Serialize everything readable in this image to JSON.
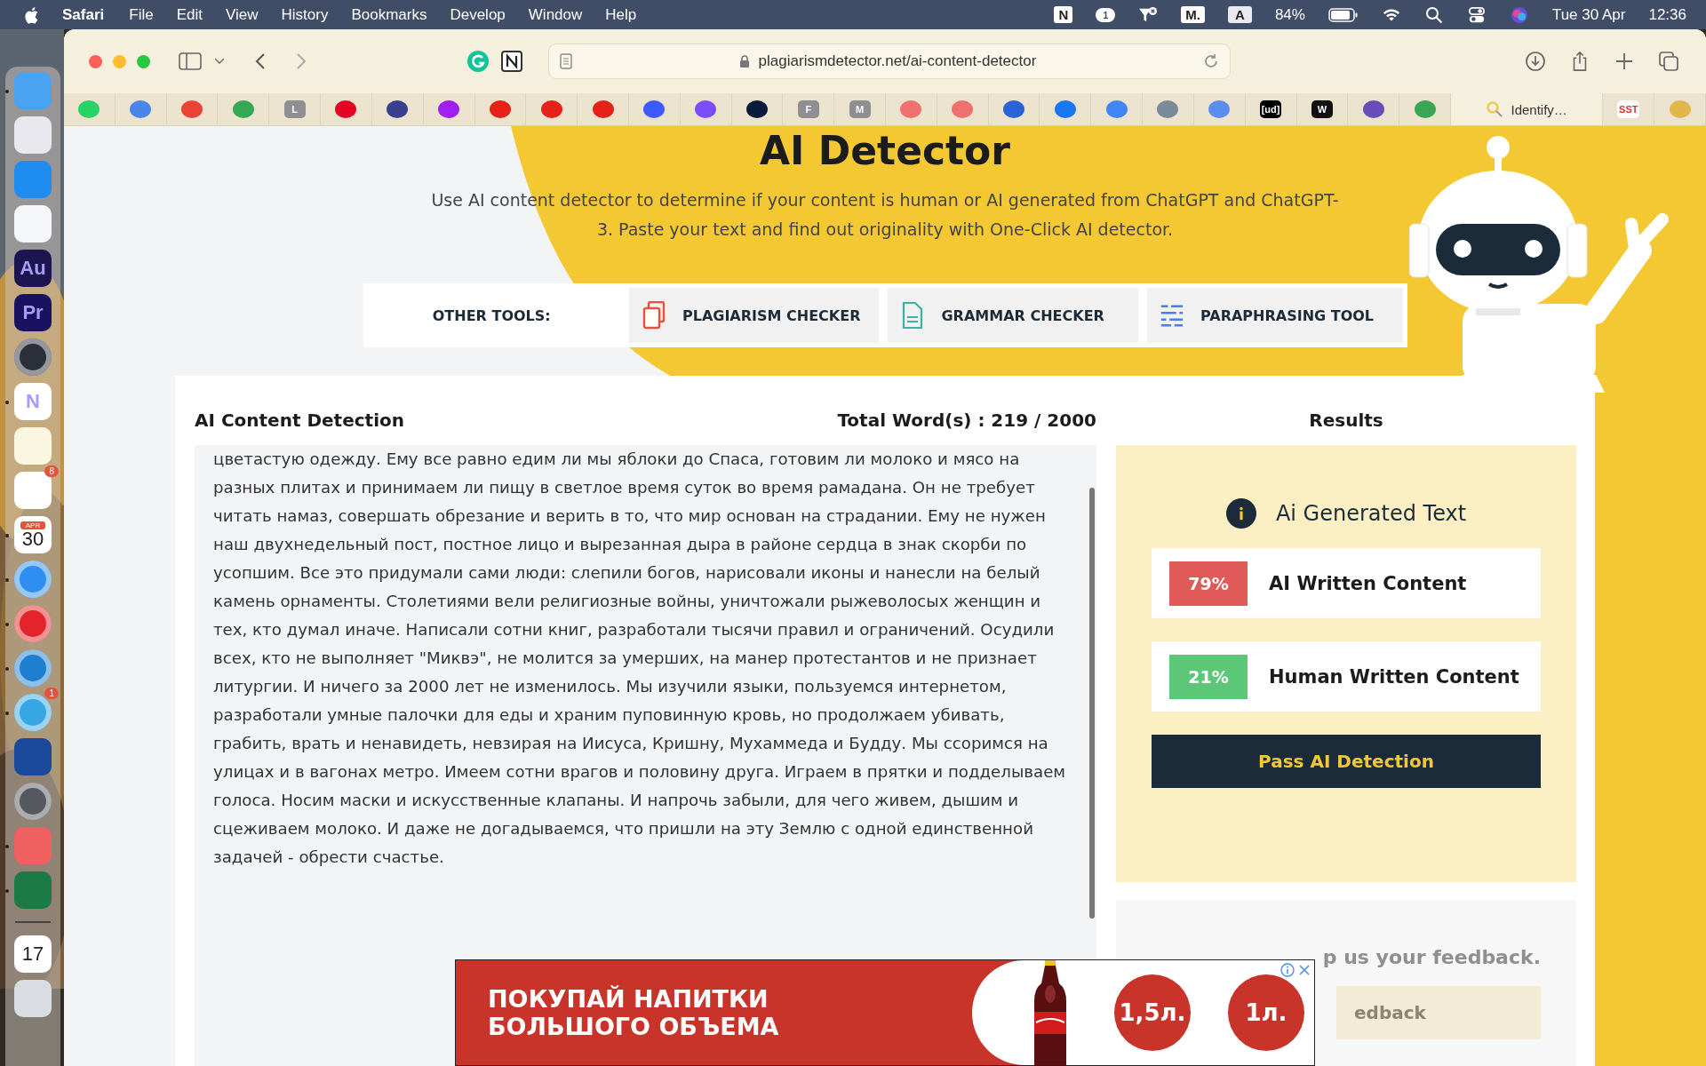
{
  "menubar": {
    "app": "Safari",
    "menus": [
      "File",
      "Edit",
      "View",
      "History",
      "Bookmarks",
      "Develop",
      "Window",
      "Help"
    ],
    "status": [
      {
        "kind": "box",
        "glyph": "N"
      },
      {
        "kind": "chat",
        "count": "1"
      },
      {
        "kind": "funnel"
      },
      {
        "kind": "box",
        "glyph": "M."
      },
      {
        "kind": "box-light",
        "glyph": "A"
      },
      {
        "kind": "text",
        "text": "84%"
      },
      {
        "kind": "battery"
      },
      {
        "kind": "wifi"
      },
      {
        "kind": "search"
      },
      {
        "kind": "control"
      },
      {
        "kind": "siri"
      },
      {
        "kind": "text",
        "text": "Tue 30 Apr"
      },
      {
        "kind": "text",
        "text": "12:36"
      }
    ]
  },
  "dock": [
    {
      "kind": "finder",
      "color": "#4aa3f0",
      "running": true
    },
    {
      "kind": "grid",
      "color": "#e8e8ee",
      "running": false
    },
    {
      "kind": "glyph",
      "color": "#1f8cf0",
      "running": false
    },
    {
      "kind": "glyph",
      "color": "#f4f6fa",
      "running": false
    },
    {
      "kind": "text",
      "color": "#1d1550",
      "label": "Au",
      "running": false
    },
    {
      "kind": "text",
      "color": "#1a1260",
      "label": "Pr",
      "running": false
    },
    {
      "kind": "ring",
      "color": "#2a2f3a",
      "running": false
    },
    {
      "kind": "text",
      "color": "#ffffff",
      "label": "N",
      "running": true
    },
    {
      "kind": "notes",
      "color": "#fbf6e0",
      "running": false
    },
    {
      "kind": "list",
      "color": "#ffffff",
      "badge": "8",
      "running": false
    },
    {
      "kind": "calendar",
      "color": "#ffffff",
      "top": "APR",
      "label": "30",
      "running": true
    },
    {
      "kind": "ring",
      "color": "#2f8ff0",
      "running": true
    },
    {
      "kind": "ring",
      "color": "#e3242b",
      "running": true
    },
    {
      "kind": "ring",
      "color": "#1e7fd0",
      "running": true
    },
    {
      "kind": "ring",
      "color": "#37a6e4",
      "badge": "1",
      "running": true
    },
    {
      "kind": "glyph",
      "color": "#1b4a9c",
      "running": false
    },
    {
      "kind": "ring",
      "color": "#55585e",
      "running": false
    },
    {
      "kind": "phone",
      "color": "#f06060",
      "running": true
    },
    {
      "kind": "glyph",
      "color": "#1c7a44",
      "running": true
    },
    {
      "kind": "separator",
      "color": "#444444",
      "running": false
    },
    {
      "kind": "calendar",
      "color": "#ffffff",
      "label": "17",
      "running": false
    },
    {
      "kind": "trash",
      "color": "#d9dde2",
      "running": false
    }
  ],
  "browser": {
    "address": "plagiarismdetector.net/ai-content-detector",
    "bookmarks": [
      {
        "kind": "icon",
        "color": "#25d366"
      },
      {
        "kind": "icon",
        "color": "#4a86e8"
      },
      {
        "kind": "icon",
        "color": "#ea4335"
      },
      {
        "kind": "icon",
        "color": "#34a853"
      },
      {
        "kind": "icon",
        "color": "#8e8e93",
        "glyph": "L"
      },
      {
        "kind": "icon",
        "color": "#e60023"
      },
      {
        "kind": "icon",
        "color": "#3b3f8f"
      },
      {
        "kind": "icon",
        "color": "#a020f0"
      },
      {
        "kind": "icon",
        "color": "#e62117"
      },
      {
        "kind": "icon",
        "color": "#e62117"
      },
      {
        "kind": "icon",
        "color": "#e62117"
      },
      {
        "kind": "icon",
        "color": "#3d5afe"
      },
      {
        "kind": "icon",
        "color": "#7b4dff"
      },
      {
        "kind": "icon",
        "color": "#0b1a3a"
      },
      {
        "kind": "icon",
        "color": "#8e8e93",
        "glyph": "F"
      },
      {
        "kind": "icon",
        "color": "#8e8e93",
        "glyph": "M"
      },
      {
        "kind": "icon",
        "color": "#f07070"
      },
      {
        "kind": "icon",
        "color": "#f07070"
      },
      {
        "kind": "icon",
        "color": "#2a62d8"
      },
      {
        "kind": "icon",
        "color": "#1877f2"
      },
      {
        "kind": "icon",
        "color": "#4285f4"
      },
      {
        "kind": "icon",
        "color": "#7a8a9a"
      },
      {
        "kind": "icon",
        "color": "#5b8cf0"
      },
      {
        "kind": "icon",
        "color": "#000000",
        "glyph": "[ud]"
      },
      {
        "kind": "icon",
        "color": "#111111",
        "glyph": "W"
      },
      {
        "kind": "icon",
        "color": "#6a4cb8"
      },
      {
        "kind": "icon",
        "color": "#3aa655"
      },
      {
        "kind": "page",
        "color": "#f2c94c",
        "label": "Identify…"
      },
      {
        "kind": "icon",
        "color": "#ffffff",
        "glyph": "SST"
      },
      {
        "kind": "icon",
        "color": "#e2b64a"
      }
    ]
  },
  "page": {
    "title": "AI Detector",
    "subtitle": "Use AI content detector to determine if your content is human or AI generated from ChatGPT and ChatGPT-3. Paste your text and find out originality with One-Click AI detector.",
    "other_tools_label": "OTHER TOOLS:",
    "tools": [
      {
        "kind": "copy",
        "label": "PLAGIARISM CHECKER"
      },
      {
        "kind": "doc",
        "label": "GRAMMAR CHECKER"
      },
      {
        "kind": "lines",
        "label": "PARAPHRASING TOOL"
      }
    ],
    "detection": {
      "heading": "AI Content Detection",
      "word_count": "Total Word(s) : 219 / 2000",
      "text": "цветастую одежду. Ему все равно едим ли мы яблоки до Спаса, готовим ли молоко и мясо на разных плитах и принимаем ли пищу в светлое время суток во время рамадана. Он не требует читать намаз, совершать обрезание и верить в то, что мир основан на страдании. Ему не нужен наш двухнедельный пост, постное лицо и вырезанная дыра в районе сердца в знак скорби по усопшим. Все это придумали сами люди: слепили богов, нарисовали иконы и нанесли на белый камень орнаменты. Столетиями вели религиозные войны, уничтожали рыжеволосых женщин и тех, кто думал иначе. Написали сотни книг, разработали тысячи правил и ограничений. Осудили всех, кто не выполняет \"Миквэ\", не молится за умерших, на манер протестантов и не признает литургии. И ничего за 2000 лет не изменилось. Мы изучили языки, пользуемся интернетом, разработали умные палочки для еды и храним пуповинную кровь, но продолжаем убивать, грабить, врать и ненавидеть, невзирая на Иисуса, Кришну, Мухаммеда и Будду. Мы ссоримся на улицах и в вагонах метро. Имеем сотни врагов и половину друга. Играем в прятки и подделываем голоса. Носим маски и искусственные клапаны. И напрочь забыли, для чего живем, дышим и сцеживаем молоко. И даже не догадываемся, что пришли на эту Землю с одной единственной задачей - обрести счастье."
    },
    "results": {
      "heading": "Results",
      "verdict": "Ai Generated Text",
      "rows": [
        {
          "percent": "79%",
          "label": "AI Written Content",
          "color": "#e05a5a"
        },
        {
          "percent": "21%",
          "label": "Human Written Content",
          "color": "#5cc877"
        }
      ],
      "button": "Pass AI Detection",
      "feedback_text": "p us your feedback.",
      "feedback_button": "edback"
    }
  },
  "ad": {
    "headline_1": "ПОКУПАЙ НАПИТКИ",
    "headline_2": "БОЛЬШОГО ОБЪЕМА",
    "sizes": [
      "1,5л.",
      "1л."
    ]
  }
}
